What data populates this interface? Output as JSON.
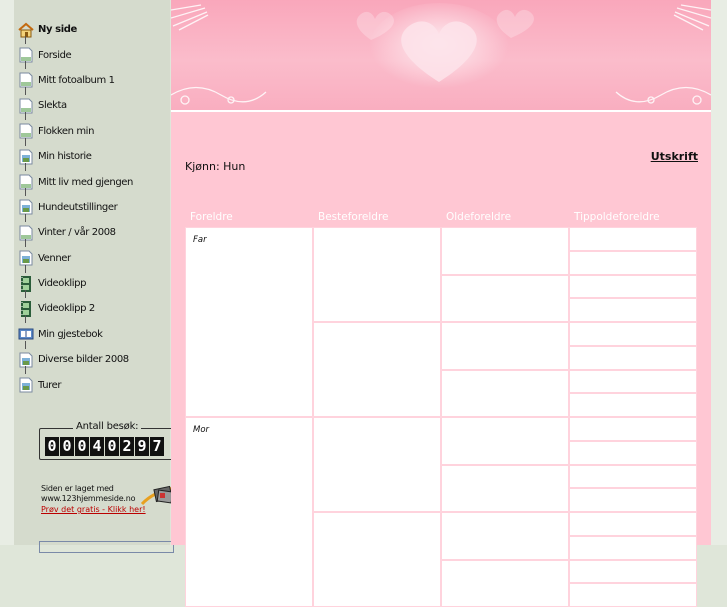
{
  "sidebar": {
    "items": [
      {
        "label": "Ny side",
        "icon": "home-icon",
        "active": true
      },
      {
        "label": "Forside",
        "icon": "page-icon"
      },
      {
        "label": "Mitt fotoalbum 1",
        "icon": "page-icon"
      },
      {
        "label": "Slekta",
        "icon": "page-icon"
      },
      {
        "label": "Flokken min",
        "icon": "page-icon"
      },
      {
        "label": "Min historie",
        "icon": "photo-page-icon"
      },
      {
        "label": "Mitt liv med gjengen",
        "icon": "page-icon"
      },
      {
        "label": "Hundeutstillinger",
        "icon": "photo-page-icon"
      },
      {
        "label": "Vinter / vår 2008",
        "icon": "page-icon"
      },
      {
        "label": "Venner",
        "icon": "photo-page-icon"
      },
      {
        "label": "Videoklipp",
        "icon": "film-icon"
      },
      {
        "label": "Videoklipp 2",
        "icon": "film-icon"
      },
      {
        "label": "Min gjestebok",
        "icon": "guestbook-icon"
      },
      {
        "label": "Diverse bilder 2008",
        "icon": "photo-page-icon"
      },
      {
        "label": "Turer",
        "icon": "photo-page-icon"
      }
    ],
    "counter": {
      "label": "Antall besøk:",
      "digits": [
        "0",
        "0",
        "0",
        "4",
        "0",
        "2",
        "9",
        "7"
      ]
    },
    "promo": {
      "line1": "Siden er laget med",
      "line2": "www.123hjemmeside.no",
      "link": "Prøv det gratis - Klikk her!"
    }
  },
  "main": {
    "print_label": "Utskrift",
    "gender_text": "Kjønn: Hun",
    "tree": {
      "headers": [
        "Foreldre",
        "Besteforeldre",
        "Oldeforeldre",
        "Tippoldeforeldre"
      ],
      "parents": [
        "Far",
        "Mor"
      ]
    }
  },
  "colors": {
    "sidebar_bg": "#d5dbcd",
    "content_bg": "#ffc7d3",
    "banner": "#f9a7bb"
  }
}
